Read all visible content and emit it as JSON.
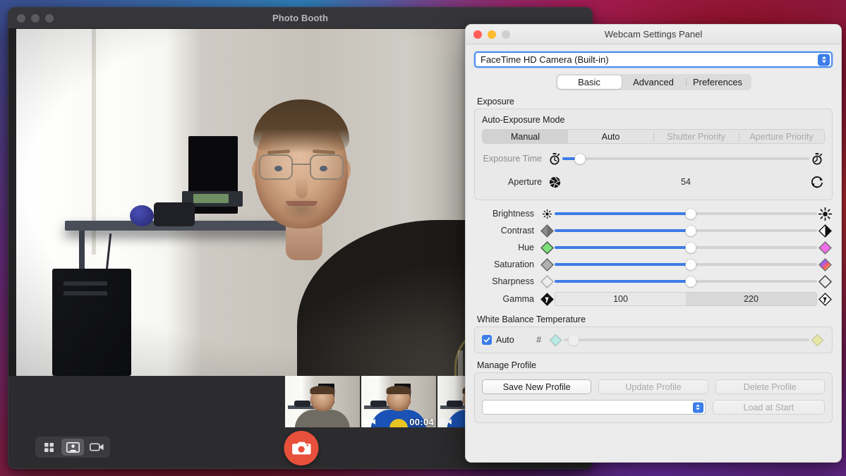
{
  "photo_booth": {
    "title": "Photo Booth",
    "modes": [
      {
        "name": "four-up-mode-button",
        "icon": "grid-icon",
        "active": false
      },
      {
        "name": "still-photo-mode-button",
        "icon": "portrait-icon",
        "active": true
      },
      {
        "name": "movie-mode-button",
        "icon": "video-camera-icon",
        "active": false
      }
    ],
    "shutter": {
      "label": "",
      "icon": "camera-icon",
      "color": "#e8503c"
    },
    "thumbnails": [
      {
        "kind": "photo",
        "badge": ""
      },
      {
        "kind": "video",
        "badge": "00:04"
      },
      {
        "kind": "video",
        "badge": ""
      }
    ]
  },
  "panel": {
    "title": "Webcam Settings Panel",
    "device": {
      "selected": "FaceTime HD Camera (Built-in)"
    },
    "tabs": [
      {
        "label": "Basic",
        "active": true
      },
      {
        "label": "Advanced",
        "active": false
      },
      {
        "label": "Preferences",
        "active": false
      }
    ],
    "exposure": {
      "group_label": "Exposure",
      "sub_label": "Auto-Exposure Mode",
      "modes": [
        {
          "label": "Manual",
          "selected": true,
          "disabled": false
        },
        {
          "label": "Auto",
          "selected": false,
          "disabled": false
        },
        {
          "label": "Shutter Priority",
          "selected": false,
          "disabled": true
        },
        {
          "label": "Aperture Priority",
          "selected": false,
          "disabled": true
        }
      ],
      "exposure_time": {
        "label": "Exposure Time",
        "value_percent": 7,
        "left_icon": "stopwatch-short-icon",
        "right_icon": "stopwatch-long-icon",
        "disabled": true
      },
      "aperture": {
        "label": "Aperture",
        "value": "54",
        "left_icon": "aperture-icon",
        "right_icon": "aperture-open-icon"
      }
    },
    "adjustments": [
      {
        "label": "Brightness",
        "value_percent": 52,
        "left_icon": "small-sun-icon",
        "right_icon": "large-sun-icon"
      },
      {
        "label": "Contrast",
        "value_percent": 52,
        "left_icon": "gray-diamond-icon",
        "right_icon": "contrast-diamond-icon"
      },
      {
        "label": "Hue",
        "value_percent": 52,
        "left_icon": "green-diamond-icon",
        "right_icon": "magenta-diamond-icon"
      },
      {
        "label": "Saturation",
        "value_percent": 52,
        "left_icon": "gray-diamond-icon",
        "right_icon": "rainbow-diamond-icon"
      },
      {
        "label": "Sharpness",
        "value_percent": 52,
        "left_icon": "outline-diamond-icon",
        "right_icon": "outline-diamond-icon"
      }
    ],
    "gamma": {
      "label": "Gamma",
      "left_icon": "gamma-dark-icon",
      "right_icon": "gamma-light-icon",
      "cells": [
        {
          "value": "100",
          "selected": false
        },
        {
          "value": "220",
          "selected": true
        }
      ]
    },
    "white_balance": {
      "group_label": "White Balance Temperature",
      "auto_label": "Auto",
      "auto_checked": true,
      "hash_label": "#",
      "left_icon": "cool-diamond-icon",
      "right_icon": "warm-diamond-icon",
      "value_percent": 4,
      "disabled": true
    },
    "manage_profile": {
      "group_label": "Manage Profile",
      "buttons": [
        {
          "label": "Save New Profile",
          "disabled": false
        },
        {
          "label": "Update Profile",
          "disabled": true
        },
        {
          "label": "Delete Profile",
          "disabled": true
        }
      ],
      "profile_field_value": "",
      "load_at_start": {
        "label": "Load at Start",
        "disabled": true
      }
    }
  },
  "colors": {
    "accent_blue": "#3e7ce6",
    "shutter_red": "#e8503c",
    "panel_bg": "#ececec",
    "photobooth_chrome": "#2c2c2e"
  }
}
